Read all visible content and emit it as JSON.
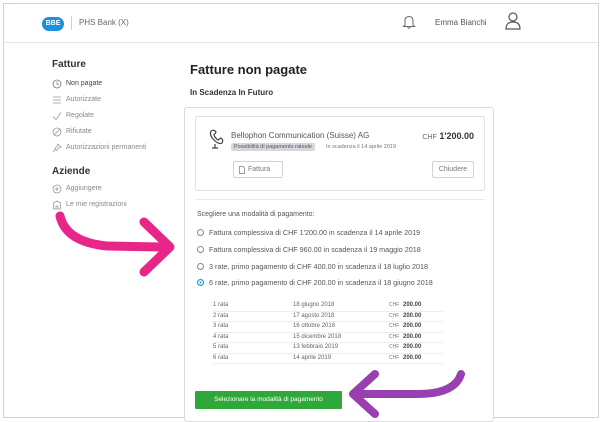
{
  "header": {
    "logo_text": "BBE",
    "bank_name": "PHS Bank (X)",
    "user_name": "Emma Bianchi"
  },
  "sidebar": {
    "section1_title": "Fatture",
    "items": [
      {
        "label": "Non pagate",
        "icon": "clock-icon",
        "active": true
      },
      {
        "label": "Autorizzate",
        "icon": "list-icon"
      },
      {
        "label": "Regolate",
        "icon": "check-icon"
      },
      {
        "label": "Rifiutate",
        "icon": "forbidden-icon"
      },
      {
        "label": "Autorizzazioni permanenti",
        "icon": "pin-icon"
      }
    ],
    "section2_title": "Aziende",
    "items2": [
      {
        "label": "Aggiungere",
        "icon": "plus-circle-icon"
      },
      {
        "label": "Le mie registrazioni",
        "icon": "building-icon"
      }
    ]
  },
  "main": {
    "title": "Fatture non pagate",
    "subtitle": "In Scadenza In Futuro"
  },
  "invoice": {
    "company": "Bellophon Communication (Suisse) AG",
    "currency": "CHF",
    "amount": "1'200.00",
    "chip": "Possibilità di pagamento rateale",
    "due": "In scadenza il 14 aprile 2019",
    "fattura_btn": "Fattura",
    "close_btn": "Chiudere"
  },
  "payment": {
    "prompt": "Scegliere una modalità di pagamento:",
    "options": [
      {
        "label": "Fattura complessiva di CHF 1'200.00 in scadenza il 14 aprile 2019",
        "selected": false
      },
      {
        "label": "Fattura complessiva di CHF 960.00 in scadenza il 19 maggio 2018",
        "selected": false
      },
      {
        "label": "3 rate, primo pagamento di CHF 400.00 in scadenza il 18 luglio 2018",
        "selected": false
      },
      {
        "label": "6 rate, primo pagamento di CHF 200.00 in scadenza il 18 giugno 2018",
        "selected": true
      }
    ],
    "rates": [
      {
        "n": "1 rata",
        "date": "18 giugno 2018",
        "cur": "CHF",
        "amount": "200.00"
      },
      {
        "n": "2 rata",
        "date": "17 agosto 2018",
        "cur": "CHF",
        "amount": "200.00"
      },
      {
        "n": "3 rata",
        "date": "16 ottobre 2018",
        "cur": "CHF",
        "amount": "200.00"
      },
      {
        "n": "4 rata",
        "date": "15 dicembre 2018",
        "cur": "CHF",
        "amount": "200.00"
      },
      {
        "n": "5 rata",
        "date": "13 febbraio 2019",
        "cur": "CHF",
        "amount": "200.00"
      },
      {
        "n": "6 rata",
        "date": "14 aprile 2019",
        "cur": "CHF",
        "amount": "200.00"
      }
    ],
    "select_btn": "Selezionare la modalità di pagamento"
  },
  "colors": {
    "accent_blue": "#1b8fe0",
    "button_green": "#2fa83a",
    "arrow_pink": "#e8268a",
    "arrow_purple": "#9a3fb0"
  }
}
